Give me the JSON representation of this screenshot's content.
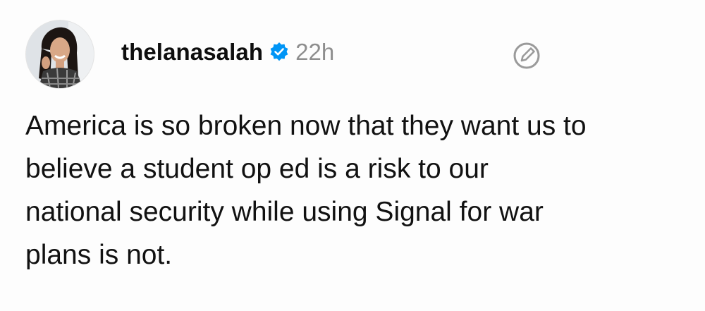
{
  "post": {
    "author": {
      "username": "thelanasalah",
      "verified": true,
      "avatar_icon": "profile-photo",
      "verified_icon": "verified-badge-icon"
    },
    "timestamp": "22h",
    "edit_icon": "edit-pencil-icon",
    "body_lines": [
      "America is so broken now that they want us to",
      "believe a student op ed is a risk to our",
      "national security while using Signal for war",
      "plans is not."
    ]
  },
  "colors": {
    "text": "#111111",
    "muted": "#8e8e8e",
    "verified_blue": "#0095f6",
    "background": "#fdfdfd"
  }
}
